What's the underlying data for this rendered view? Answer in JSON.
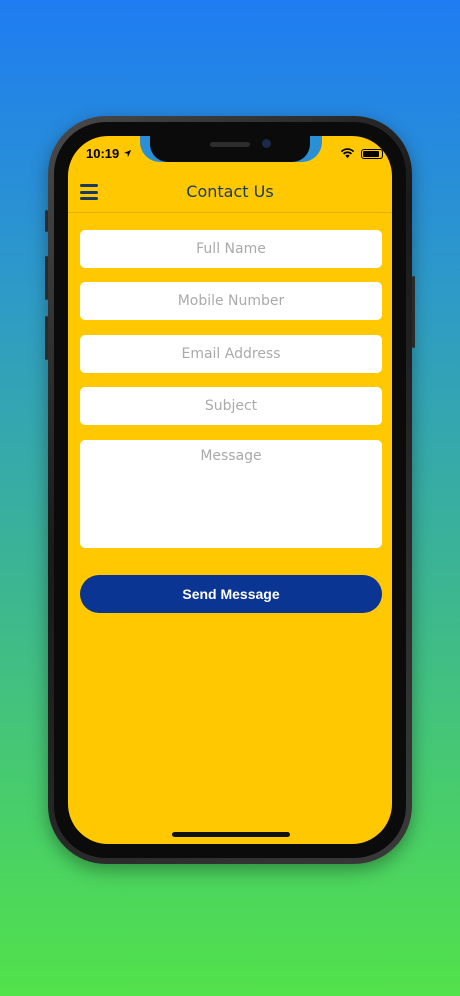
{
  "status_bar": {
    "time": "10:19",
    "location_icon": "location-arrow-icon",
    "wifi_icon": "wifi-icon",
    "battery_icon": "battery-icon"
  },
  "header": {
    "title": "Contact Us",
    "menu_icon": "hamburger-menu-icon"
  },
  "form": {
    "full_name": {
      "placeholder": "Full Name",
      "value": ""
    },
    "mobile": {
      "placeholder": "Mobile Number",
      "value": ""
    },
    "email": {
      "placeholder": "Email Address",
      "value": ""
    },
    "subject": {
      "placeholder": "Subject",
      "value": ""
    },
    "message": {
      "placeholder": "Message",
      "value": ""
    },
    "send_label": "Send Message"
  },
  "colors": {
    "screen_bg": "#ffc800",
    "accent": "#0b3593",
    "title": "#1b3a63"
  }
}
